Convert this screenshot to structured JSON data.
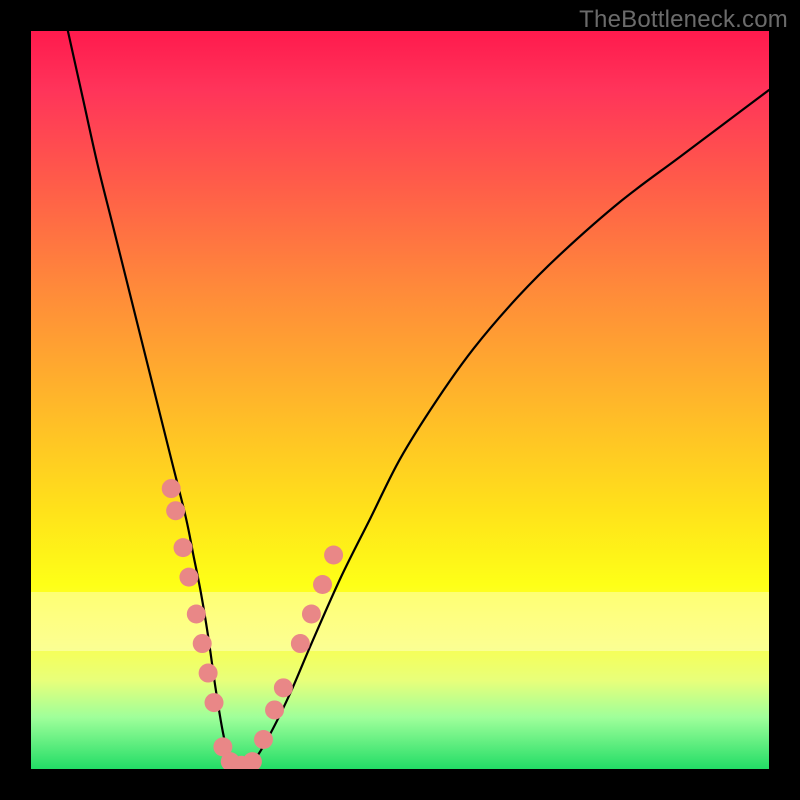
{
  "watermark": {
    "text": "TheBottleneck.com"
  },
  "colors": {
    "curve_stroke": "#000000",
    "marker_fill": "#e98787",
    "marker_stroke": "#d57070"
  },
  "chart_data": {
    "type": "line",
    "title": "",
    "xlabel": "",
    "ylabel": "",
    "xlim": [
      0,
      100
    ],
    "ylim": [
      0,
      100
    ],
    "grid": false,
    "legend": false,
    "series": [
      {
        "name": "bottleneck-curve",
        "x": [
          5,
          7,
          9,
          11,
          13,
          15,
          17,
          19,
          21,
          22,
          23,
          24,
          25,
          26,
          27,
          28,
          30,
          32,
          35,
          38,
          42,
          46,
          50,
          55,
          60,
          66,
          72,
          80,
          88,
          96,
          100
        ],
        "values": [
          100,
          91,
          82,
          74,
          66,
          58,
          50,
          42,
          34,
          29,
          24,
          18,
          11,
          5,
          1,
          0,
          1,
          4,
          10,
          17,
          26,
          34,
          42,
          50,
          57,
          64,
          70,
          77,
          83,
          89,
          92
        ]
      }
    ],
    "markers": [
      {
        "name": "left-cluster-1",
        "x": 19.0,
        "y": 38
      },
      {
        "name": "left-cluster-2",
        "x": 19.6,
        "y": 35
      },
      {
        "name": "left-cluster-3",
        "x": 20.6,
        "y": 30
      },
      {
        "name": "left-cluster-4",
        "x": 21.4,
        "y": 26
      },
      {
        "name": "left-cluster-5",
        "x": 22.4,
        "y": 21
      },
      {
        "name": "left-cluster-6",
        "x": 23.2,
        "y": 17
      },
      {
        "name": "left-cluster-7",
        "x": 24.0,
        "y": 13
      },
      {
        "name": "left-cluster-8",
        "x": 24.8,
        "y": 9
      },
      {
        "name": "valley-1",
        "x": 26.0,
        "y": 3
      },
      {
        "name": "valley-2",
        "x": 27.0,
        "y": 1
      },
      {
        "name": "valley-3",
        "x": 28.5,
        "y": 0.5
      },
      {
        "name": "valley-4",
        "x": 30.0,
        "y": 1
      },
      {
        "name": "right-cluster-1",
        "x": 31.5,
        "y": 4
      },
      {
        "name": "right-cluster-2",
        "x": 33.0,
        "y": 8
      },
      {
        "name": "right-cluster-3",
        "x": 34.2,
        "y": 11
      },
      {
        "name": "right-cluster-4",
        "x": 36.5,
        "y": 17
      },
      {
        "name": "right-cluster-5",
        "x": 38.0,
        "y": 21
      },
      {
        "name": "right-cluster-6",
        "x": 39.5,
        "y": 25
      },
      {
        "name": "right-cluster-7",
        "x": 41.0,
        "y": 29
      }
    ]
  }
}
